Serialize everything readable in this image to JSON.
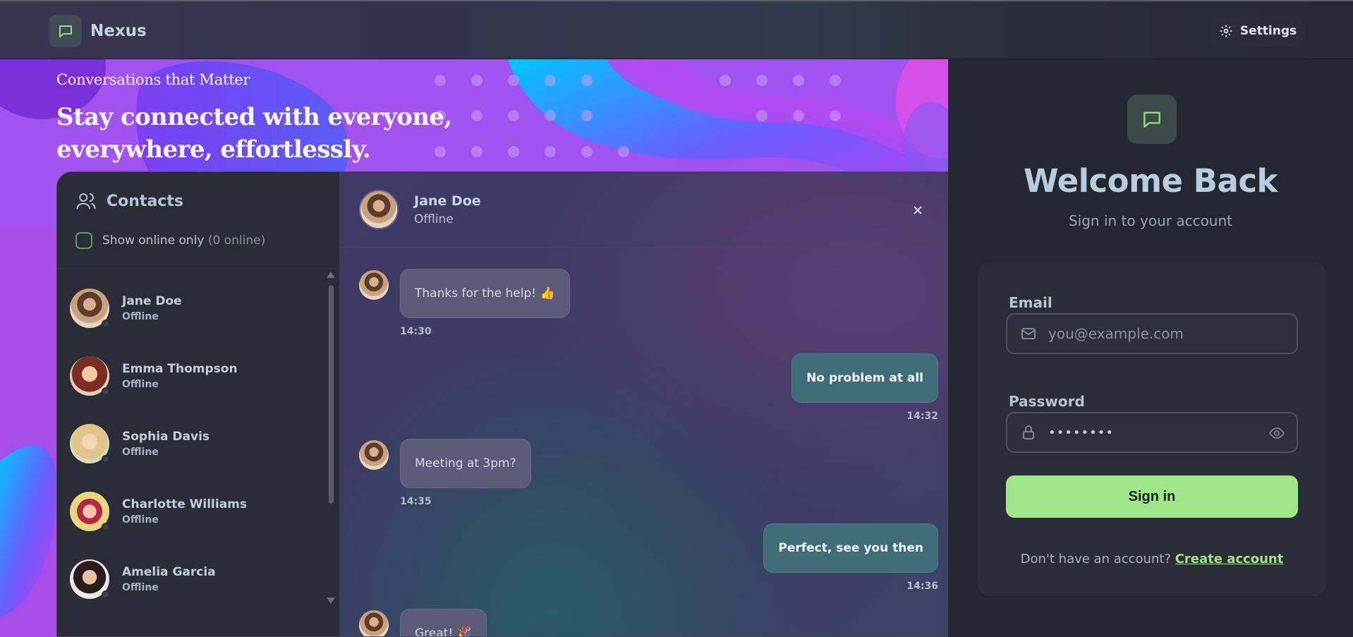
{
  "app": {
    "name": "Nexus"
  },
  "header": {
    "settings_label": "Settings"
  },
  "hero": {
    "kicker": "Conversations that Matter",
    "title": "Stay connected with everyone, everywhere, effortlessly."
  },
  "contacts": {
    "title": "Contacts",
    "filter_label": "Show online only",
    "online_count": "(0 online)",
    "items": [
      {
        "name": "Jane Doe",
        "status": "Offline"
      },
      {
        "name": "Emma Thompson",
        "status": "Offline"
      },
      {
        "name": "Sophia Davis",
        "status": "Offline"
      },
      {
        "name": "Charlotte Williams",
        "status": "Offline"
      },
      {
        "name": "Amelia Garcia",
        "status": "Offline"
      }
    ]
  },
  "chat": {
    "name": "Jane Doe",
    "status": "Offline",
    "messages": [
      {
        "direction": "in",
        "text": "Thanks for the help! 👍",
        "time": "14:30"
      },
      {
        "direction": "out",
        "text": "No problem at all",
        "time": "14:32"
      },
      {
        "direction": "in",
        "text": "Meeting at 3pm?",
        "time": "14:35"
      },
      {
        "direction": "out",
        "text": "Perfect, see you then",
        "time": "14:36"
      },
      {
        "direction": "in",
        "text": "Great! 🎉",
        "time": ""
      }
    ]
  },
  "auth": {
    "title": "Welcome Back",
    "subtitle": "Sign in to your account",
    "email_label": "Email",
    "email_placeholder": "you@example.com",
    "password_label": "Password",
    "password_value": "••••••••",
    "signin_label": "Sign in",
    "signup_prompt": "Don't have an account?",
    "signup_link": "Create account"
  },
  "colors": {
    "accent": "#9ee68a",
    "hero_purple": "#a84fe6",
    "panel_dark": "#24272f"
  },
  "icons": [
    "chat-bubble-icon",
    "gear-icon",
    "users-icon",
    "close-icon",
    "mail-icon",
    "lock-icon",
    "eye-icon"
  ]
}
